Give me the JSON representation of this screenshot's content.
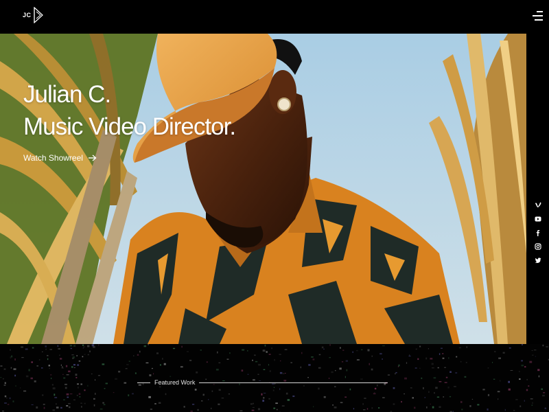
{
  "header": {
    "logo_text": "JC",
    "menu_icon": "hamburger-menu-icon"
  },
  "hero": {
    "title_line1": "Julian C.",
    "title_line2": "Music Video Director.",
    "cta_label": "Watch Showreel",
    "cta_icon": "arrow-right-icon"
  },
  "social": {
    "items": [
      {
        "name": "vimeo-icon",
        "glyph": "v"
      },
      {
        "name": "youtube-icon",
        "glyph": "▶"
      },
      {
        "name": "facebook-icon",
        "glyph": "f"
      },
      {
        "name": "instagram-icon",
        "glyph": "◎"
      },
      {
        "name": "twitter-icon",
        "glyph": "✦"
      }
    ]
  },
  "featured": {
    "label": "Featured Work"
  },
  "colors": {
    "background": "#000000",
    "text": "#ffffff",
    "cap": "#e19a3a",
    "shirt_orange": "#d9821f",
    "shirt_dark": "#1e2a26"
  }
}
